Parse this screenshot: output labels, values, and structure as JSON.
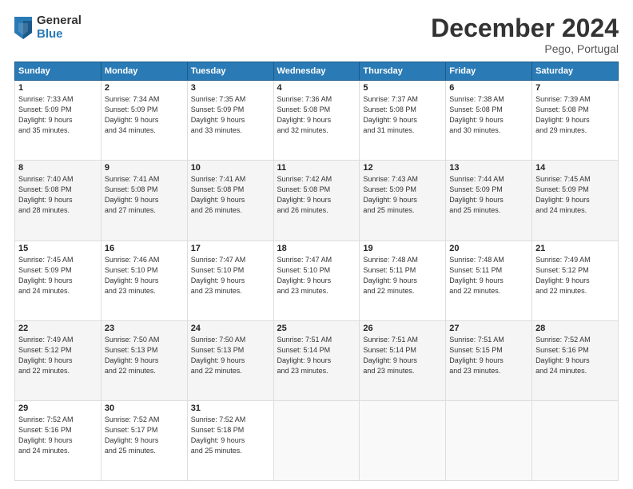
{
  "logo": {
    "general": "General",
    "blue": "Blue"
  },
  "title": "December 2024",
  "location": "Pego, Portugal",
  "headers": [
    "Sunday",
    "Monday",
    "Tuesday",
    "Wednesday",
    "Thursday",
    "Friday",
    "Saturday"
  ],
  "weeks": [
    [
      {
        "day": "1",
        "info": "Sunrise: 7:33 AM\nSunset: 5:09 PM\nDaylight: 9 hours\nand 35 minutes."
      },
      {
        "day": "2",
        "info": "Sunrise: 7:34 AM\nSunset: 5:09 PM\nDaylight: 9 hours\nand 34 minutes."
      },
      {
        "day": "3",
        "info": "Sunrise: 7:35 AM\nSunset: 5:09 PM\nDaylight: 9 hours\nand 33 minutes."
      },
      {
        "day": "4",
        "info": "Sunrise: 7:36 AM\nSunset: 5:08 PM\nDaylight: 9 hours\nand 32 minutes."
      },
      {
        "day": "5",
        "info": "Sunrise: 7:37 AM\nSunset: 5:08 PM\nDaylight: 9 hours\nand 31 minutes."
      },
      {
        "day": "6",
        "info": "Sunrise: 7:38 AM\nSunset: 5:08 PM\nDaylight: 9 hours\nand 30 minutes."
      },
      {
        "day": "7",
        "info": "Sunrise: 7:39 AM\nSunset: 5:08 PM\nDaylight: 9 hours\nand 29 minutes."
      }
    ],
    [
      {
        "day": "8",
        "info": "Sunrise: 7:40 AM\nSunset: 5:08 PM\nDaylight: 9 hours\nand 28 minutes."
      },
      {
        "day": "9",
        "info": "Sunrise: 7:41 AM\nSunset: 5:08 PM\nDaylight: 9 hours\nand 27 minutes."
      },
      {
        "day": "10",
        "info": "Sunrise: 7:41 AM\nSunset: 5:08 PM\nDaylight: 9 hours\nand 26 minutes."
      },
      {
        "day": "11",
        "info": "Sunrise: 7:42 AM\nSunset: 5:08 PM\nDaylight: 9 hours\nand 26 minutes."
      },
      {
        "day": "12",
        "info": "Sunrise: 7:43 AM\nSunset: 5:09 PM\nDaylight: 9 hours\nand 25 minutes."
      },
      {
        "day": "13",
        "info": "Sunrise: 7:44 AM\nSunset: 5:09 PM\nDaylight: 9 hours\nand 25 minutes."
      },
      {
        "day": "14",
        "info": "Sunrise: 7:45 AM\nSunset: 5:09 PM\nDaylight: 9 hours\nand 24 minutes."
      }
    ],
    [
      {
        "day": "15",
        "info": "Sunrise: 7:45 AM\nSunset: 5:09 PM\nDaylight: 9 hours\nand 24 minutes."
      },
      {
        "day": "16",
        "info": "Sunrise: 7:46 AM\nSunset: 5:10 PM\nDaylight: 9 hours\nand 23 minutes."
      },
      {
        "day": "17",
        "info": "Sunrise: 7:47 AM\nSunset: 5:10 PM\nDaylight: 9 hours\nand 23 minutes."
      },
      {
        "day": "18",
        "info": "Sunrise: 7:47 AM\nSunset: 5:10 PM\nDaylight: 9 hours\nand 23 minutes."
      },
      {
        "day": "19",
        "info": "Sunrise: 7:48 AM\nSunset: 5:11 PM\nDaylight: 9 hours\nand 22 minutes."
      },
      {
        "day": "20",
        "info": "Sunrise: 7:48 AM\nSunset: 5:11 PM\nDaylight: 9 hours\nand 22 minutes."
      },
      {
        "day": "21",
        "info": "Sunrise: 7:49 AM\nSunset: 5:12 PM\nDaylight: 9 hours\nand 22 minutes."
      }
    ],
    [
      {
        "day": "22",
        "info": "Sunrise: 7:49 AM\nSunset: 5:12 PM\nDaylight: 9 hours\nand 22 minutes."
      },
      {
        "day": "23",
        "info": "Sunrise: 7:50 AM\nSunset: 5:13 PM\nDaylight: 9 hours\nand 22 minutes."
      },
      {
        "day": "24",
        "info": "Sunrise: 7:50 AM\nSunset: 5:13 PM\nDaylight: 9 hours\nand 22 minutes."
      },
      {
        "day": "25",
        "info": "Sunrise: 7:51 AM\nSunset: 5:14 PM\nDaylight: 9 hours\nand 23 minutes."
      },
      {
        "day": "26",
        "info": "Sunrise: 7:51 AM\nSunset: 5:14 PM\nDaylight: 9 hours\nand 23 minutes."
      },
      {
        "day": "27",
        "info": "Sunrise: 7:51 AM\nSunset: 5:15 PM\nDaylight: 9 hours\nand 23 minutes."
      },
      {
        "day": "28",
        "info": "Sunrise: 7:52 AM\nSunset: 5:16 PM\nDaylight: 9 hours\nand 24 minutes."
      }
    ],
    [
      {
        "day": "29",
        "info": "Sunrise: 7:52 AM\nSunset: 5:16 PM\nDaylight: 9 hours\nand 24 minutes."
      },
      {
        "day": "30",
        "info": "Sunrise: 7:52 AM\nSunset: 5:17 PM\nDaylight: 9 hours\nand 25 minutes."
      },
      {
        "day": "31",
        "info": "Sunrise: 7:52 AM\nSunset: 5:18 PM\nDaylight: 9 hours\nand 25 minutes."
      },
      {
        "day": "",
        "info": ""
      },
      {
        "day": "",
        "info": ""
      },
      {
        "day": "",
        "info": ""
      },
      {
        "day": "",
        "info": ""
      }
    ]
  ]
}
